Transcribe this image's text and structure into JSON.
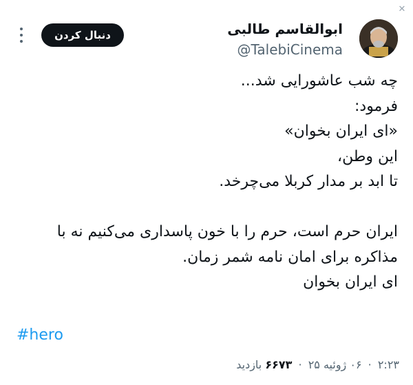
{
  "tweet": {
    "author_name": "ابوالقاسم طالبی",
    "handle": "@TalebiCinema",
    "follow_label": "دنبال کردن",
    "lines": [
      "چه شب عاشورایی شد...",
      "فرمود:",
      "«ای ایران بخوان»",
      "این وطن،",
      "تا ابد بر مدار کربلا می‌چرخد.",
      "",
      "ایران حرم است، حرم را با خون پاسداری می‌کنیم نه با",
      "مذاکره برای امان نامه شمر زمان.",
      "ای ایران بخوان"
    ],
    "hashtag": "#hero",
    "time": "۲:۲۳",
    "date": "۰۶ ژوئیه ۲۵",
    "views": "۶۶۷۳",
    "views_label": "بازدید"
  }
}
